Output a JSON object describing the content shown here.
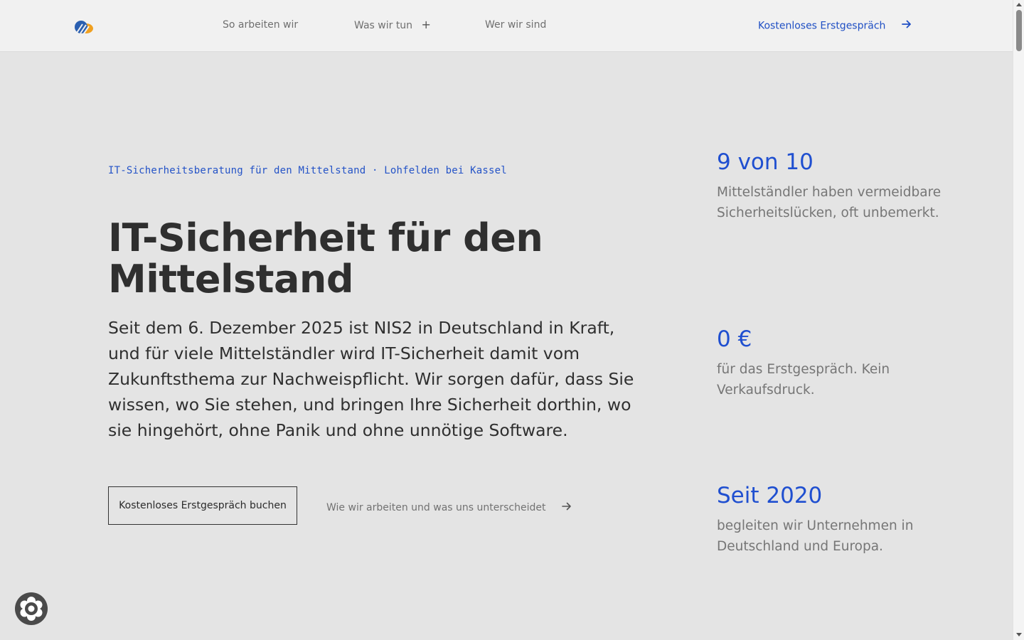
{
  "header": {
    "nav": [
      {
        "label": "So arbeiten wir"
      },
      {
        "label": "Was wir tun",
        "has_submenu": true,
        "submenu_icon": "plus-icon"
      },
      {
        "label": "Wer wir sind"
      }
    ],
    "cta_label": "Kostenloses Erstgespräch",
    "cta_icon": "arrow-right-icon"
  },
  "hero": {
    "eyebrow": "IT-Sicherheitsberatung für den Mittelstand · Lohfelden bei Kassel",
    "title": "IT-Sicherheit für den Mittelstand",
    "text": "Seit dem 6. Dezember 2025 ist NIS2 in Deutschland in Kraft, und für viele Mittelständler wird IT-Sicherheit damit vom Zukunftsthema zur Nachweispflicht. Wir sorgen dafür, dass Sie wissen, wo Sie stehen, und bringen Ihre Sicherheit dorthin, wo sie hingehört, ohne Panik und ohne unnötige Software.",
    "primary_button": "Kostenloses Erstgespräch buchen",
    "secondary_link": "Wie wir arbeiten und was uns unterscheidet"
  },
  "stats": [
    {
      "value": "9 von 10",
      "description": "Mittelständler haben vermeidbare Sicherheitslücken, oft unbemerkt."
    },
    {
      "value": "0 €",
      "description": "für das Erstgespräch. Kein Verkaufsdruck."
    },
    {
      "value": "Seit 2020",
      "description": "begleiten wir Unternehmen in Deutschland und Europa."
    }
  ],
  "colors": {
    "accent": "#1f4fd0",
    "text": "#2f2f2f",
    "muted": "#767676",
    "header_bg": "#f1f1f1",
    "page_bg": "#e4e4e4",
    "logo_blue": "#2a5fb0",
    "logo_orange": "#f0a020"
  },
  "icons": {
    "logo": "logo-icon",
    "float_button": "cookie-settings-icon"
  }
}
